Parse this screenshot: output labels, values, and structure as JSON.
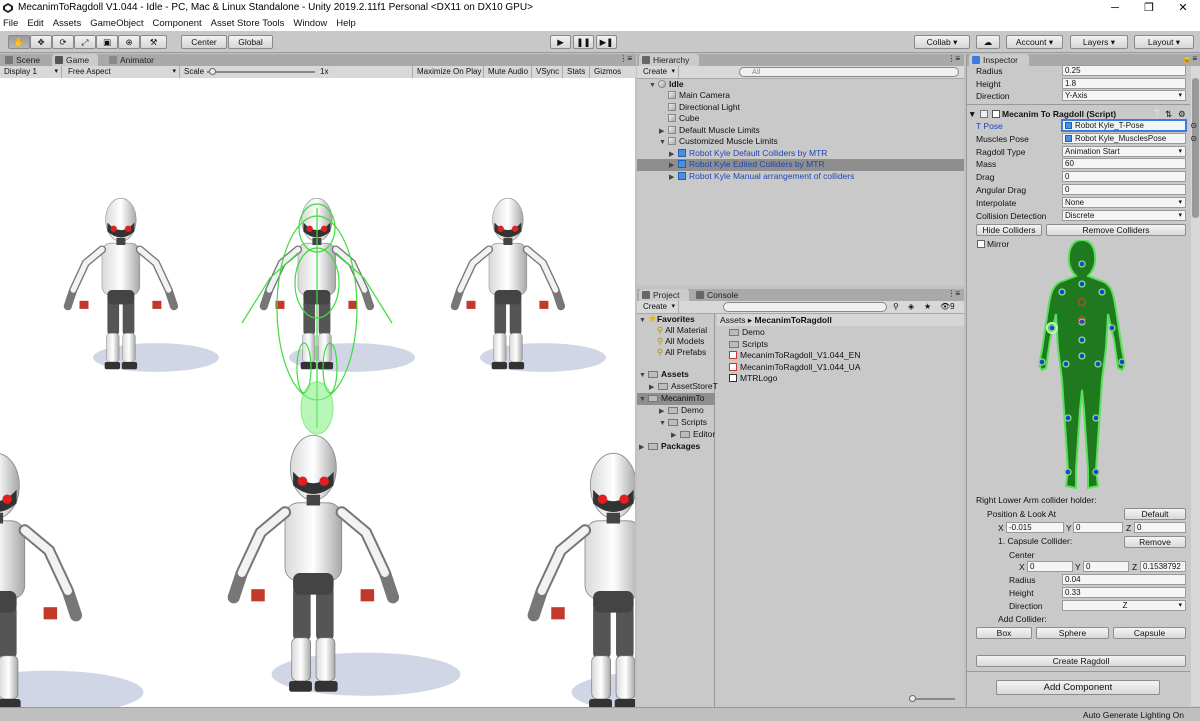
{
  "window": {
    "title": "MecanimToRagdoll V1.044 - Idle - PC, Mac & Linux Standalone - Unity 2019.2.11f1 Personal <DX11 on DX10 GPU>",
    "min": "─",
    "max": "❐",
    "close": "✕"
  },
  "menu": [
    "File",
    "Edit",
    "Assets",
    "GameObject",
    "Component",
    "Asset Store Tools",
    "Window",
    "Help"
  ],
  "toolbar": {
    "tools": [
      "hand-tool",
      "move-tool",
      "rotate-tool",
      "scale-tool",
      "rect-tool",
      "transform-tool",
      "custom-tool"
    ],
    "tool_glyphs": [
      "✋",
      "✥",
      "⟳",
      "⤢",
      "▣",
      "⊕",
      "⚒"
    ],
    "pivot": "Center",
    "space": "Global",
    "play": "▶",
    "pause": "❚❚",
    "step": "▶❚",
    "collab": "Collab ▾",
    "cloud": "☁",
    "account": "Account",
    "layers": "Layers",
    "layout": "Layout"
  },
  "scene_tabs": {
    "scene": "Scene",
    "game": "Game",
    "animator": "Animator"
  },
  "game_bar": {
    "display": "Display 1",
    "aspect": "Free Aspect",
    "scale_label": "Scale",
    "scale_value": "1x",
    "scale_fraction": 0.02,
    "maximize": "Maximize On Play",
    "mute": "Mute Audio",
    "vsync": "VSync",
    "stats": "Stats",
    "gizmos": "Gizmos"
  },
  "hierarchy": {
    "tab": "Hierarchy",
    "create": "Create",
    "search_placeholder": "All",
    "scene": "Idle",
    "items": [
      {
        "label": "Main Camera",
        "prefab": false,
        "indent": 1,
        "tri": ""
      },
      {
        "label": "Directional Light",
        "prefab": false,
        "indent": 1,
        "tri": ""
      },
      {
        "label": "Cube",
        "prefab": false,
        "indent": 1,
        "tri": ""
      },
      {
        "label": "Default Muscle Limits",
        "prefab": false,
        "indent": 1,
        "tri": "▶"
      },
      {
        "label": "Customized Muscle Limits",
        "prefab": false,
        "indent": 1,
        "tri": "▼"
      },
      {
        "label": "Robot Kyle Default Colliders by MTR",
        "prefab": true,
        "indent": 2,
        "tri": "▶"
      },
      {
        "label": "Robot Kyle Edited Colliders by MTR",
        "prefab": true,
        "indent": 2,
        "tri": "▶",
        "selected": true
      },
      {
        "label": "Robot Kyle Manual arrangement of colliders",
        "prefab": true,
        "indent": 2,
        "tri": "▶"
      }
    ]
  },
  "project": {
    "tab": "Project",
    "console_tab": "Console",
    "create": "Create",
    "count": "9",
    "favorites": {
      "label": "Favorites",
      "items": [
        "All Material",
        "All Models",
        "All Prefabs"
      ]
    },
    "assets": {
      "label": "Assets",
      "items": [
        "AssetStoreT",
        "MecanimTo",
        "Demo",
        "Scripts",
        "Editor"
      ]
    },
    "packages": "Packages",
    "breadcrumb": [
      "Assets",
      "MecanimToRagdoll"
    ],
    "files": [
      {
        "name": "Demo",
        "kind": "folder"
      },
      {
        "name": "Scripts",
        "kind": "folder"
      },
      {
        "name": "MecanimToRagdoll_V1.044_EN",
        "kind": "pdf"
      },
      {
        "name": "MecanimToRagdoll_V1.044_UA",
        "kind": "pdf"
      },
      {
        "name": "MTRLogo",
        "kind": "image"
      }
    ]
  },
  "inspector": {
    "tab": "Inspector",
    "capsule": {
      "radius_label": "Radius",
      "radius": "0.25",
      "height_label": "Height",
      "height": "1.8",
      "direction_label": "Direction",
      "direction": "Y-Axis"
    },
    "component": "Mecanim To Ragdoll (Script)",
    "props": [
      {
        "label": "T Pose",
        "value": "Robot Kyle_T-Pose",
        "kind": "obj",
        "hl": true
      },
      {
        "label": "Muscles Pose",
        "value": "Robot Kyle_MusclesPose",
        "kind": "obj"
      },
      {
        "label": "Ragdoll Type",
        "value": "Animation Start",
        "kind": "dd"
      },
      {
        "label": "Mass",
        "value": "60",
        "kind": "num"
      },
      {
        "label": "Drag",
        "value": "0",
        "kind": "num"
      },
      {
        "label": "Angular Drag",
        "value": "0",
        "kind": "num"
      },
      {
        "label": "Interpolate",
        "value": "None",
        "kind": "dd"
      },
      {
        "label": "Collision Detection",
        "value": "Discrete",
        "kind": "dd"
      }
    ],
    "hide_colliders": "Hide Colliders",
    "remove_colliders": "Remove Colliders",
    "mirror": "Mirror",
    "holder": "Right Lower Arm collider holder:",
    "pos_look": "Position & Look At",
    "default_btn": "Default",
    "pos": {
      "x": "-0.015",
      "y": "0",
      "z": "0"
    },
    "capsule_collider": "1. Capsule Collider:",
    "remove_btn": "Remove",
    "center_label": "Center",
    "center": {
      "x": "0",
      "y": "0",
      "z": "0.1538792"
    },
    "radius_label": "Radius",
    "radius": "0.04",
    "height_label": "Height",
    "height": "0.33",
    "direction_label": "Direction",
    "direction": "Z",
    "add_collider": "Add Collider:",
    "box": "Box",
    "sphere": "Sphere",
    "capsule_btn": "Capsule",
    "create_ragdoll": "Create Ragdoll",
    "add_component": "Add Component"
  },
  "status": "Auto Generate Lighting On",
  "colors": {
    "accent": "#3b7ce0",
    "selected_row": "#8e8e8e",
    "body_green": "#1f9b1f"
  }
}
